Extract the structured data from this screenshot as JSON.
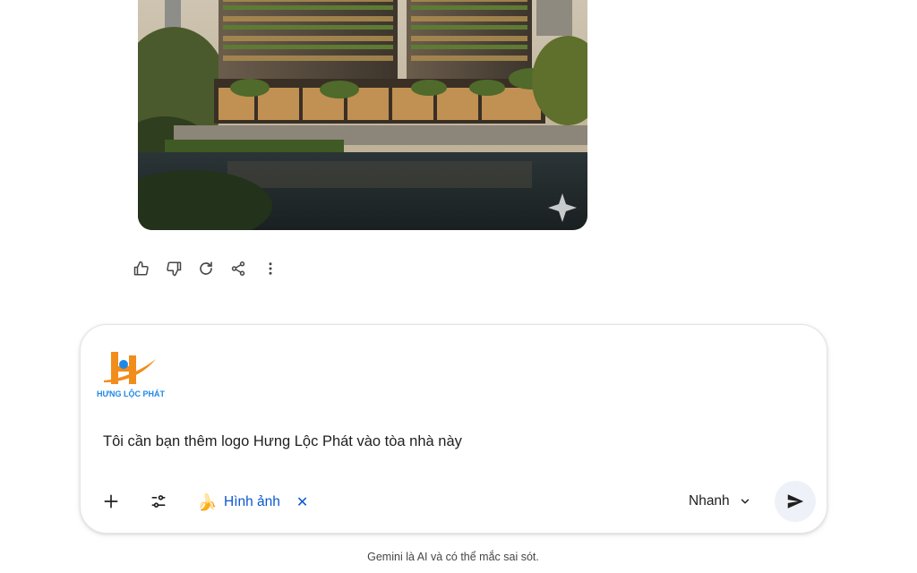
{
  "image": {
    "watermark_icon": "sparkle-icon"
  },
  "actions": [
    {
      "name": "thumbs-up-icon",
      "label": ""
    },
    {
      "name": "thumbs-down-icon",
      "label": ""
    },
    {
      "name": "redo-icon",
      "label": ""
    },
    {
      "name": "share-icon",
      "label": ""
    },
    {
      "name": "more-vert-icon",
      "label": ""
    }
  ],
  "composer": {
    "attachment_logo_text": "HƯNG LỘC PHÁT",
    "prompt": "Tôi cần bạn thêm logo Hưng Lộc Phát vào tòa nhà này",
    "add_icon": "plus-icon",
    "tools_icon": "tune-icon",
    "chip": {
      "emoji": "🍌",
      "label": "Hình ảnh",
      "close": "✕"
    },
    "mode": "Nhanh",
    "send_icon": "send-icon"
  },
  "footer": {
    "disclaimer": "Gemini là AI và có thể mắc sai sót."
  },
  "colors": {
    "accent": "#0b57d0",
    "logo_orange": "#f28c1b",
    "logo_blue": "#1e88e5"
  }
}
